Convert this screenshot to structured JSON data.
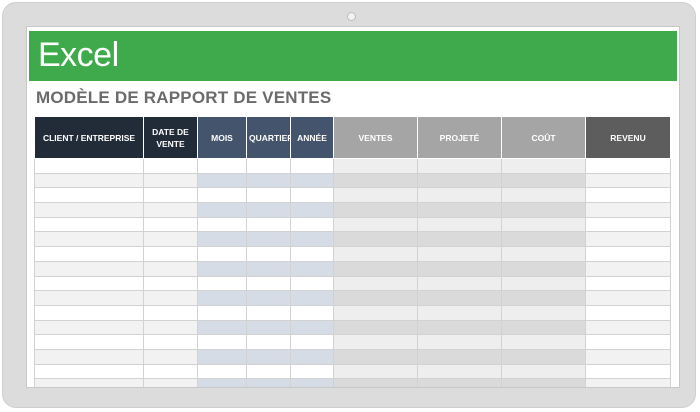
{
  "app": {
    "name": "Excel"
  },
  "sheet": {
    "title": "MODÈLE DE RAPPORT DE VENTES"
  },
  "colors": {
    "banner": "#3faa4b",
    "header_dark": "#222b38",
    "header_blue": "#44546c",
    "header_gray": "#a5a5a5",
    "header_revenue": "#5d5d5d"
  },
  "table": {
    "columns": [
      {
        "label": "CLIENT / ENTREPRISE",
        "style": "dark"
      },
      {
        "label": "DATE DE VENTE",
        "style": "dark"
      },
      {
        "label": "MOIS",
        "style": "blue"
      },
      {
        "label": "QUARTIER",
        "style": "blue"
      },
      {
        "label": "ANNÉE",
        "style": "blue"
      },
      {
        "label": "VENTES",
        "style": "gray"
      },
      {
        "label": "PROJETÉ",
        "style": "gray"
      },
      {
        "label": "COÛT",
        "style": "gray"
      },
      {
        "label": "REVENU",
        "style": "rev"
      }
    ],
    "row_count": 16
  }
}
